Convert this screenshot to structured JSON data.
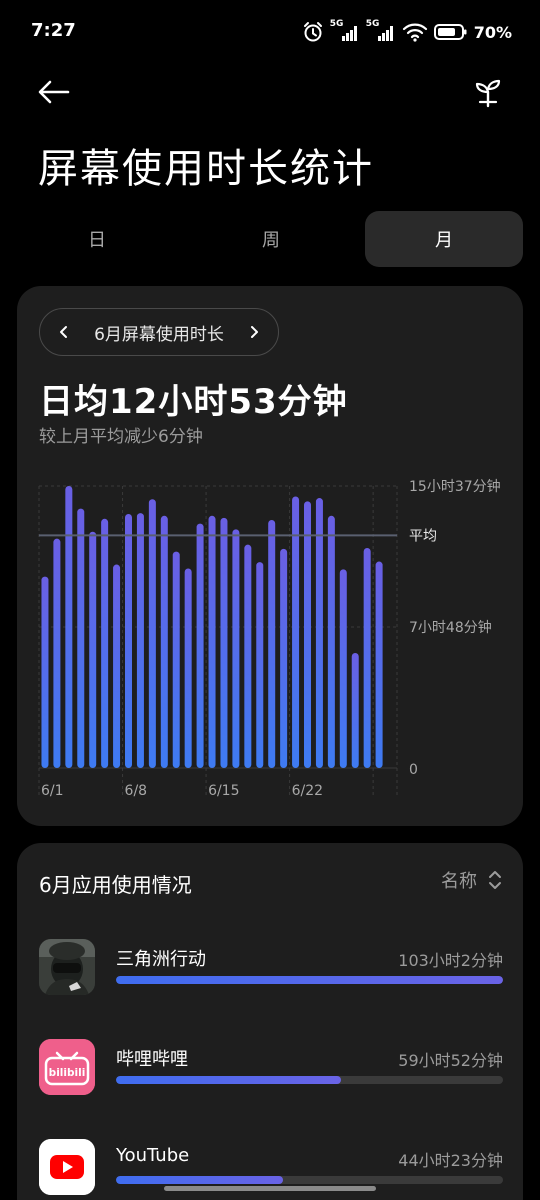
{
  "status_bar": {
    "time": "7:27",
    "battery_percent": "70%",
    "network_1": "5G",
    "network_2": "5G",
    "icons": [
      "alarm-icon",
      "signal-5g-icon",
      "signal-5g-icon",
      "wifi-icon",
      "battery-icon"
    ]
  },
  "header": {
    "back_icon": "back-arrow-icon",
    "action_icon": "sprout-icon",
    "title": "屏幕使用时长统计"
  },
  "tabs": [
    {
      "label": "日",
      "active": false
    },
    {
      "label": "周",
      "active": false
    },
    {
      "label": "月",
      "active": true
    }
  ],
  "summary": {
    "period_label": "6月屏幕使用时长",
    "daily_average": "日均12小时53分钟",
    "comparison": "较上月平均减少6分钟"
  },
  "chart_data": {
    "type": "bar",
    "title": "",
    "xlabel": "",
    "ylabel": "",
    "categories": [
      "6/1",
      "6/2",
      "6/3",
      "6/4",
      "6/5",
      "6/6",
      "6/7",
      "6/8",
      "6/9",
      "6/10",
      "6/11",
      "6/12",
      "6/13",
      "6/14",
      "6/15",
      "6/16",
      "6/17",
      "6/18",
      "6/19",
      "6/20",
      "6/21",
      "6/22",
      "6/23",
      "6/24",
      "6/25",
      "6/26",
      "6/27",
      "6/28",
      "6/29",
      "6/30"
    ],
    "x_tick_labels": [
      "6/1",
      "6/8",
      "6/15",
      "6/22"
    ],
    "y_tick_labels": [
      "15小时37分钟",
      "7小时48分钟",
      "0"
    ],
    "average_label": "平均",
    "average_minutes": 773,
    "ylim_minutes": [
      0,
      937
    ],
    "values_minutes": [
      636,
      762,
      937,
      862,
      785,
      828,
      676,
      844,
      847,
      893,
      838,
      719,
      663,
      812,
      838,
      831,
      793,
      742,
      684,
      824,
      728,
      902,
      886,
      897,
      838,
      660,
      382,
      731,
      686
    ],
    "series": [
      {
        "name": "",
        "color": "#5b63e8"
      }
    ],
    "grid": true,
    "colors": {
      "bar_top": "#6a5fe4",
      "bar_bottom": "#3e7bf2",
      "average_line": "#5a6070"
    }
  },
  "app_usage": {
    "title": "6月应用使用情况",
    "sort_label": "名称",
    "sort_icon": "sort-updown-icon",
    "apps": [
      {
        "name": "三角洲行动",
        "time": "103小时2分钟",
        "fraction": 1.0,
        "icon": "delta-force-app-icon"
      },
      {
        "name": "哔哩哔哩",
        "time": "59小时52分钟",
        "fraction": 0.581,
        "icon": "bilibili-app-icon",
        "icon_text": "bilibili"
      },
      {
        "name": "YouTube",
        "time": "44小时23分钟",
        "fraction": 0.431,
        "icon": "youtube-app-icon"
      }
    ]
  }
}
